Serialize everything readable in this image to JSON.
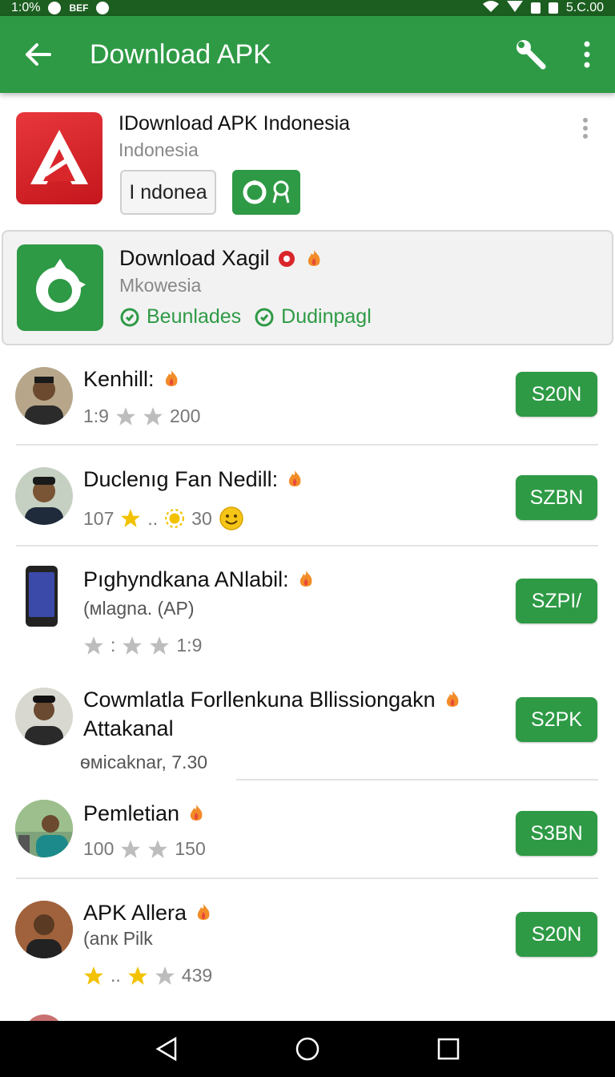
{
  "status_bar": {
    "left_text": "1:0%",
    "carrier": "BEF",
    "time": "5.C.00"
  },
  "app_bar": {
    "title": "Download APK"
  },
  "featured": [
    {
      "title": "IDownload APK Indonesia",
      "subtitle": "Indonesia",
      "chip_label": "I ndonea"
    },
    {
      "title": "Download Xagil",
      "subtitle": "Mkowesia",
      "links": [
        "Beunlades",
        "Dudinpagl"
      ]
    }
  ],
  "rows": [
    {
      "title": "Kenhill:",
      "meta_left": "1:9",
      "meta_right": "200",
      "button": "S20N"
    },
    {
      "title": "Duclenıg Fan Nedill:",
      "meta_left": "107",
      "meta_dots": "..",
      "meta_right": "30",
      "button": "SZBN"
    },
    {
      "title": "Pıghyndkana ANlabil:",
      "subtitle": "(мlagna. (AP)",
      "meta_right": "1:9",
      "meta_dots": ":",
      "button": "SZPI/"
    },
    {
      "title": "Cowmlatla Forllenkuna Bllissiongakn",
      "title2": "Attakanal",
      "subtitle": "ѳмicaknar, 7.30",
      "button": "S2PK"
    },
    {
      "title": "Pemletian",
      "meta_left": "100",
      "meta_right": "150",
      "button": "S3BN"
    },
    {
      "title": "APK Allera",
      "subtitle": "(anк Pilk",
      "meta_dots": "..",
      "meta_right": "439",
      "button": "S20N"
    }
  ],
  "colors": {
    "primary": "#2e9a45",
    "status_bar": "#1b5e20",
    "accent_red": "#d9262b",
    "star_gold": "#f2c200",
    "star_gray": "#bdbdbd"
  }
}
